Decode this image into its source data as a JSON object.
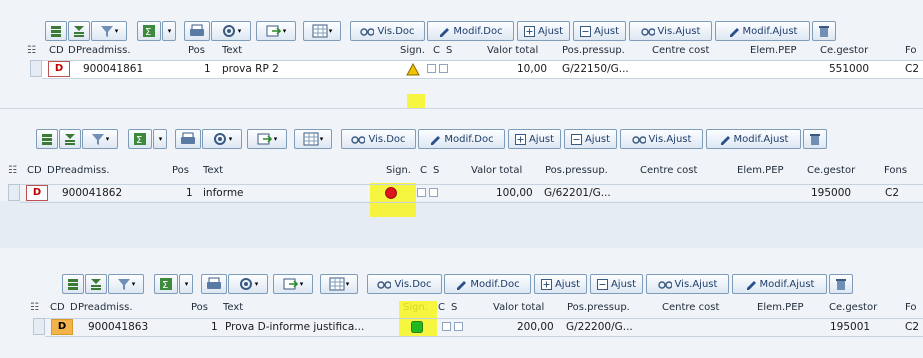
{
  "toolbar": {
    "vis_doc": "Vis.Doc",
    "modif_doc": "Modif.Doc",
    "ajust_plus": "Ajust",
    "ajust_minus": "Ajust",
    "vis_ajust": "Vis.Ajust",
    "modif_ajust": "Modif.Ajust"
  },
  "headers": {
    "cd": "CD",
    "d": "D",
    "preadmiss": "Preadmiss.",
    "pos": "Pos",
    "text": "Text",
    "sign": "Sign.",
    "c": "C",
    "s": "S",
    "valor_total": "Valor total",
    "pos_pressup": "Pos.pressup.",
    "centre_cost": "Centre cost",
    "elem_pep": "Elem.PEP",
    "ce_gestor": "Ce.gestor",
    "fons_full": "Fons",
    "fons_short1": "Fo",
    "fons_short3": "Fo"
  },
  "rows": [
    {
      "cd": "D",
      "preadmiss": "900041861",
      "pos": "1",
      "text": "prova RP 2",
      "signal": "warning",
      "valor_total": "10,00",
      "pos_pressup": "G/22150/G...",
      "centre_cost": "",
      "elem_pep": "",
      "ce_gestor": "551000",
      "fons": "C2"
    },
    {
      "cd": "D",
      "preadmiss": "900041862",
      "pos": "1",
      "text": "informe",
      "signal": "red",
      "valor_total": "100,00",
      "pos_pressup": "G/62201/G...",
      "centre_cost": "",
      "elem_pep": "",
      "ce_gestor": "195000",
      "fons": "C2"
    },
    {
      "cd": "D",
      "preadmiss": "900041863",
      "pos": "1",
      "text": "Prova D-informe justifica...",
      "signal": "green",
      "valor_total": "200,00",
      "pos_pressup": "G/22200/G...",
      "centre_cost": "",
      "elem_pep": "",
      "ce_gestor": "195001",
      "fons": "C2"
    }
  ],
  "colors": {
    "highlight": "#f7f41e",
    "signal_red": "#e0141e",
    "signal_green": "#22b822",
    "signal_warning": "#f2c200",
    "toolbar_border": "#7f9db9"
  }
}
